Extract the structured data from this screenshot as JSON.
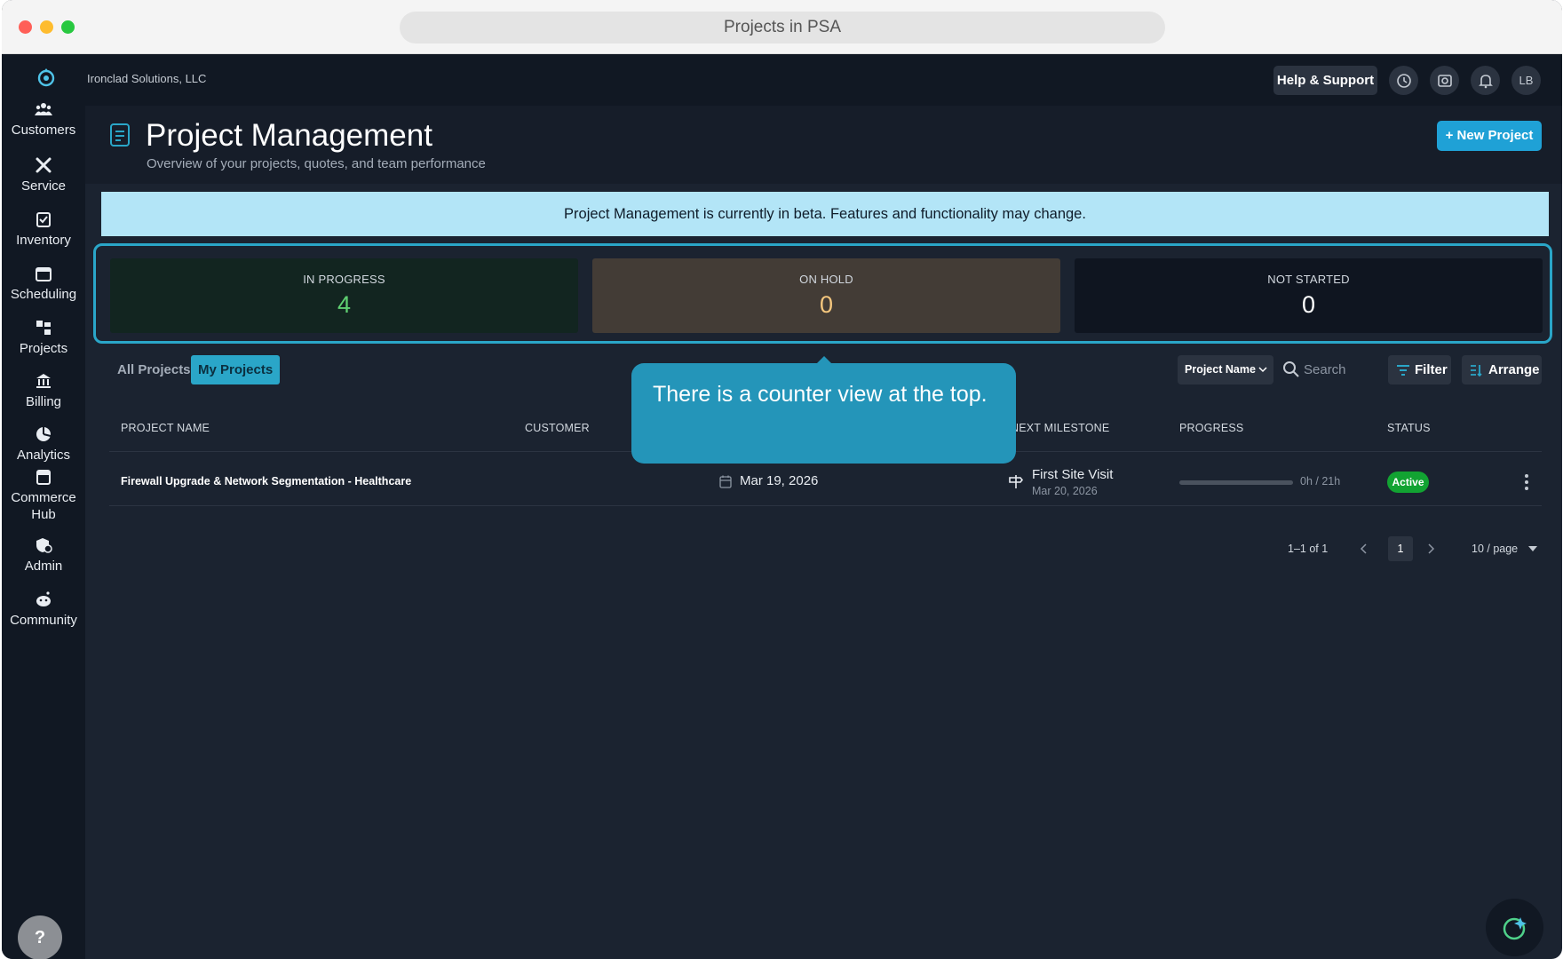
{
  "window": {
    "title": "Projects in PSA"
  },
  "sidebar": {
    "items": [
      {
        "label": "Customers",
        "icon": "customers-icon"
      },
      {
        "label": "Service",
        "icon": "service-icon"
      },
      {
        "label": "Inventory",
        "icon": "inventory-icon"
      },
      {
        "label": "Scheduling",
        "icon": "calendar-icon"
      },
      {
        "label": "Projects",
        "icon": "projects-icon"
      },
      {
        "label": "Billing",
        "icon": "bank-icon"
      },
      {
        "label": "Analytics",
        "icon": "pie-chart-icon"
      },
      {
        "label": "Commerce\nHub",
        "icon": "store-icon"
      },
      {
        "label": "Admin",
        "icon": "admin-shield-icon"
      },
      {
        "label": "Community",
        "icon": "community-icon"
      }
    ],
    "help_label": "?"
  },
  "topbar": {
    "org_name": "Ironclad Solutions, LLC",
    "help_support_label": "Help & Support",
    "avatar_initials": "LB"
  },
  "header": {
    "title": "Project Management",
    "subtitle": "Overview of your projects, quotes, and team performance",
    "new_project_label": "+ New Project"
  },
  "banner": {
    "text": "Project Management is currently in beta. Features and functionality may change."
  },
  "counters": [
    {
      "label": "IN PROGRESS",
      "value": "4",
      "color": "#5fd072"
    },
    {
      "label": "ON HOLD",
      "value": "0",
      "color": "#f5c77e"
    },
    {
      "label": "NOT STARTED",
      "value": "0",
      "color": "#ffffff"
    }
  ],
  "tabs": [
    {
      "label": "All Projects",
      "active": false
    },
    {
      "label": "My Projects",
      "active": true
    }
  ],
  "toolbar": {
    "search_field_select": "Project Name",
    "search_placeholder": "Search",
    "filter_label": "Filter",
    "arrange_label": "Arrange"
  },
  "table": {
    "headers": [
      "PROJECT NAME",
      "CUSTOMER",
      "NEXT MILESTONE",
      "PROGRESS",
      "STATUS"
    ],
    "rows": [
      {
        "name": "Firewall Upgrade & Network Segmentation - Healthcare",
        "date": "Mar 19, 2026",
        "milestone_name": "First Site Visit",
        "milestone_date": "Mar 20, 2026",
        "progress_fraction": 0.0,
        "progress_text": "0h / 21h",
        "status": "Active",
        "status_color": "#12a332"
      }
    ]
  },
  "pagination": {
    "range": "1–1 of 1",
    "current_page": "1",
    "page_size": "10 / page"
  },
  "tooltip": {
    "text": "There is a counter view at the top."
  },
  "colors": {
    "accent": "#1fa1d6",
    "highlight": "#2aa6c8",
    "background": "#1b2330"
  }
}
